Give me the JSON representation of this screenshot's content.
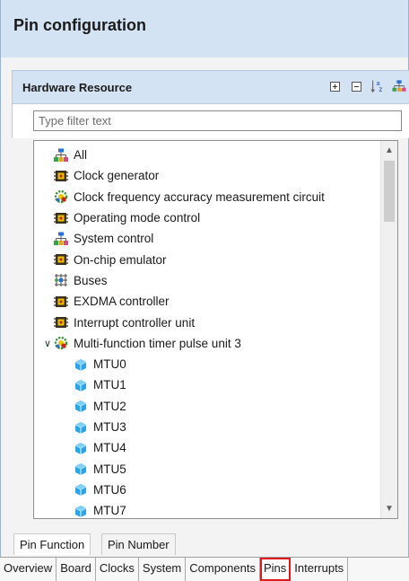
{
  "title": "Pin configuration",
  "hardware_resource": {
    "title": "Hardware Resource",
    "tools": [
      "expand-all-icon",
      "collapse-all-icon",
      "sort-az-icon",
      "hierarchy-icon"
    ]
  },
  "filter": {
    "placeholder": "Type filter text",
    "value": ""
  },
  "tree": [
    {
      "label": "All",
      "icon": "all-blocks-icon",
      "expander": ""
    },
    {
      "label": "Clock generator",
      "icon": "chip-icon",
      "expander": ""
    },
    {
      "label": "Clock frequency accuracy measurement circuit",
      "icon": "gear-colored-icon",
      "expander": ""
    },
    {
      "label": "Operating mode control",
      "icon": "chip-icon",
      "expander": ""
    },
    {
      "label": "System control",
      "icon": "all-blocks-icon",
      "expander": ""
    },
    {
      "label": "On-chip emulator",
      "icon": "chip-icon",
      "expander": ""
    },
    {
      "label": "Buses",
      "icon": "bus-grid-icon",
      "expander": ""
    },
    {
      "label": "EXDMA controller",
      "icon": "chip-icon",
      "expander": ""
    },
    {
      "label": "Interrupt controller unit",
      "icon": "chip-icon",
      "expander": ""
    },
    {
      "label": "Multi-function timer pulse unit 3",
      "icon": "gear-colored-icon",
      "expander": "∨"
    },
    {
      "label": "MTU0",
      "icon": "blue-cube-icon",
      "expander": ""
    },
    {
      "label": "MTU1",
      "icon": "blue-cube-icon",
      "expander": ""
    },
    {
      "label": "MTU2",
      "icon": "blue-cube-icon",
      "expander": ""
    },
    {
      "label": "MTU3",
      "icon": "blue-cube-icon",
      "expander": ""
    },
    {
      "label": "MTU4",
      "icon": "blue-cube-icon",
      "expander": ""
    },
    {
      "label": "MTU5",
      "icon": "blue-cube-icon",
      "expander": ""
    },
    {
      "label": "MTU6",
      "icon": "blue-cube-icon",
      "expander": ""
    },
    {
      "label": "MTU7",
      "icon": "blue-cube-icon",
      "expander": ""
    }
  ],
  "bottom_tabs": [
    "Pin Function",
    "Pin Number"
  ],
  "editor_tabs": [
    "Overview",
    "Board",
    "Clocks",
    "System",
    "Components",
    "Pins",
    "Interrupts"
  ],
  "selected_editor_tab": "Pins",
  "colors": {
    "header_bg": "#d4e3f3",
    "highlight": "#e0191f",
    "cube_blue": "#2aa6e8",
    "chip_yellow": "#e8c600",
    "chip_red": "#c0281d"
  }
}
